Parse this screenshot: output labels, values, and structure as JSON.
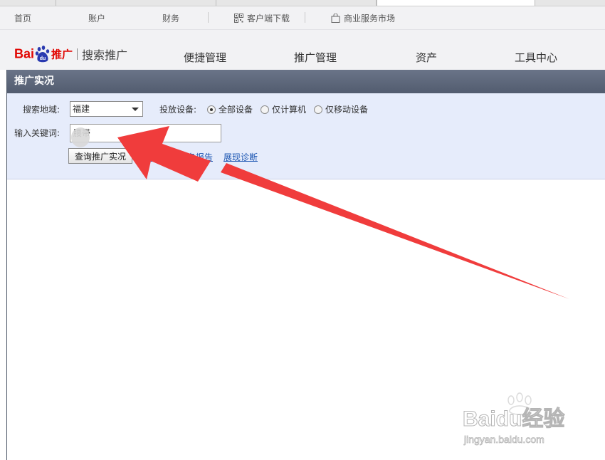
{
  "topnav": {
    "items": [
      "首页",
      "账户",
      "财务"
    ],
    "client_download": "客户端下载",
    "market": "商业服务市场"
  },
  "logo": {
    "bai": "Bai",
    "du": "du",
    "tuiguang": "推广",
    "sub": "搜索推广"
  },
  "mainnav": [
    "便捷管理",
    "推广管理",
    "资产",
    "工具中心"
  ],
  "panel": {
    "title": "推广实况",
    "region_label": "搜索地域:",
    "region_value": "福建",
    "device_label": "投放设备:",
    "devices": [
      {
        "label": "全部设备",
        "checked": true
      },
      {
        "label": "仅计算机",
        "checked": false
      },
      {
        "label": "仅移动设备",
        "checked": false
      }
    ],
    "keyword_label": "输入关键词:",
    "keyword_value": "腰带",
    "query_button": "查询推广实况",
    "link_report": "查询实时排名报告",
    "link_diagnose": "展现诊断"
  },
  "watermark": {
    "line1": "Baidu经验",
    "line2": "jingyan.baidu.com"
  },
  "colors": {
    "brand_red": "#e10602",
    "annotation_arrow": "#f03c3c",
    "link_blue": "#1e57b3",
    "panel_header": "#5b6578",
    "form_bg": "#e6ecfb"
  }
}
